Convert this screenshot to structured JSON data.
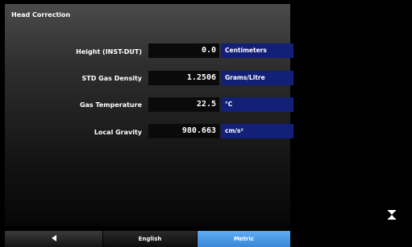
{
  "panel": {
    "title": "Head Correction"
  },
  "rows": [
    {
      "label": "Height (INST-DUT)",
      "value": "0.0",
      "unit": "Centimeters"
    },
    {
      "label": "STD Gas Density",
      "value": "1.2506",
      "unit": "Grams/Litre"
    },
    {
      "label": "Gas Temperature",
      "value": "22.5",
      "unit": "°C"
    },
    {
      "label": "Local Gravity",
      "value": "980.663",
      "unit": "cm/s²"
    }
  ],
  "bottom_bar": {
    "back_icon": "left-arrow-icon",
    "english_label": "English",
    "metric_label": "Metric"
  },
  "status": {
    "busy_icon": "hourglass-icon"
  },
  "colors": {
    "unit_bg": "#132078",
    "value_bg": "#0a0a0a",
    "active_tab": "#4a9be6",
    "background": "#000000"
  }
}
